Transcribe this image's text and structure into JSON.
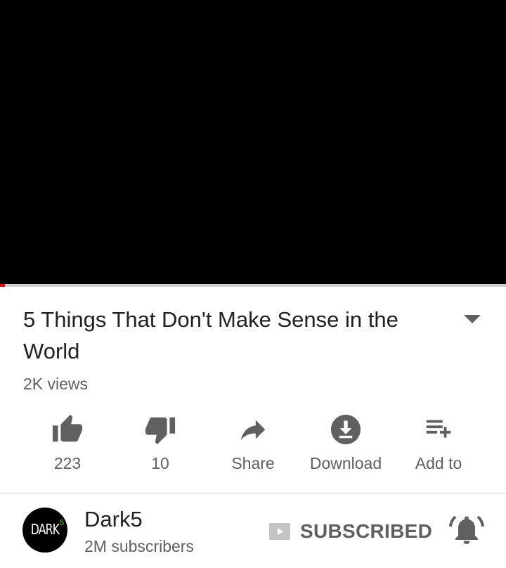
{
  "player": {
    "progress": 0.01,
    "progress_color": "#ff0000"
  },
  "video": {
    "title": "5 Things That Don't Make Sense in the World",
    "views": "2K views"
  },
  "actions": [
    {
      "icon": "thumbs-up-icon",
      "label": "223"
    },
    {
      "icon": "thumbs-down-icon",
      "label": "10"
    },
    {
      "icon": "share-icon",
      "label": "Share"
    },
    {
      "icon": "download-icon",
      "label": "Download"
    },
    {
      "icon": "add-to-playlist-icon",
      "label": "Add to"
    }
  ],
  "channel": {
    "logo_text": "DARK",
    "logo_superscript": "5",
    "name": "Dark5",
    "subscribers": "2M subscribers",
    "subscribed_label": "SUBSCRIBED"
  },
  "colors": {
    "icon_gray": "#606060",
    "text_dark": "#212121",
    "accent": "#ff0000"
  }
}
